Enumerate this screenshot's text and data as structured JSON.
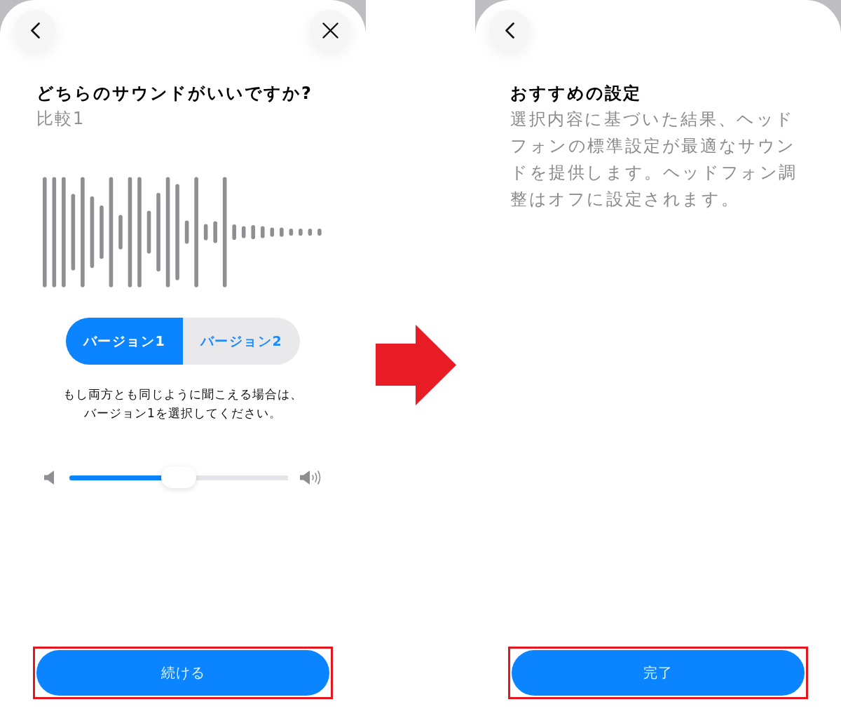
{
  "screens": [
    {
      "kind": "comparison",
      "nav_buttons": [
        {
          "kind": "back"
        },
        {
          "kind": "close"
        }
      ],
      "title": "どちらのサウンドがいいですか?",
      "subtitle": "比較1",
      "segments": [
        {
          "label": "バージョン1",
          "selected": true
        },
        {
          "label": "バージョン2",
          "selected": false
        }
      ],
      "note": "もし両方とも同じように聞こえる場合は、バージョン1を選択してください。",
      "volume": {
        "level": 0.5
      },
      "primary_button": {
        "label": "続ける",
        "highlighted": true
      }
    },
    {
      "kind": "result",
      "nav_buttons": [
        {
          "kind": "back"
        }
      ],
      "title": "おすすめの設定",
      "description": "選択内容に基づいた結果、ヘッドフォンの標準設定が最適なサウンドを提供します。ヘッドフォン調整はオフに設定されます。",
      "primary_button": {
        "label": "完了",
        "highlighted": true
      }
    }
  ]
}
